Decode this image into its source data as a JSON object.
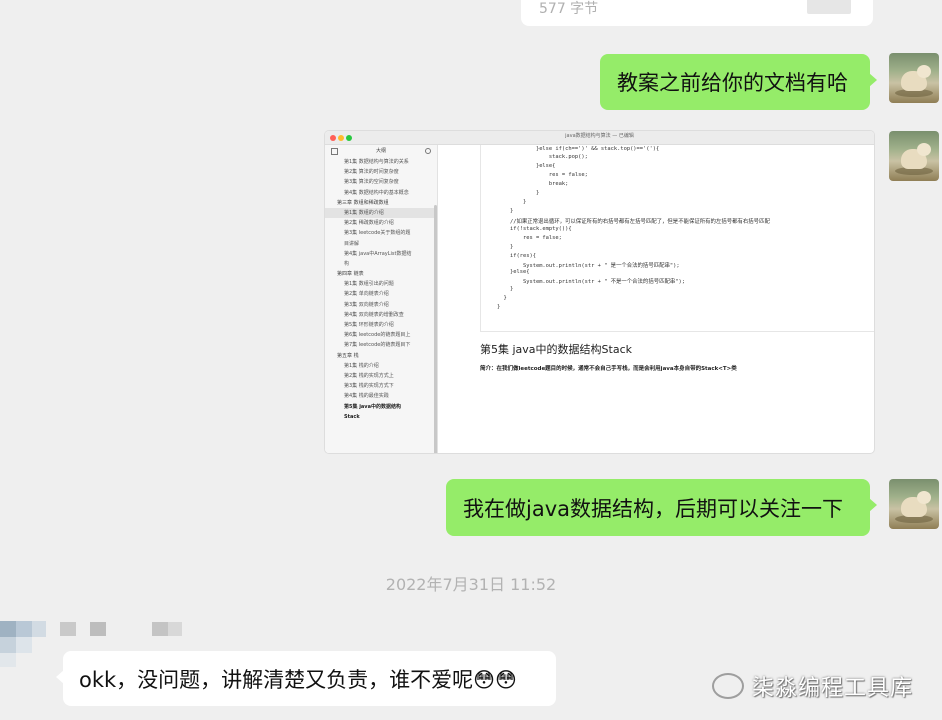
{
  "chat": {
    "top_partial_text": "577 字节",
    "messages": [
      {
        "from": "me",
        "text": "教案之前给你的文档有哈"
      },
      {
        "from": "me",
        "text": "我在做java数据结构，后期可以关注一下"
      },
      {
        "from": "other",
        "text": "okk，没问题，讲解清楚又负责，谁不爱呢😳😳"
      }
    ],
    "timestamp": "2022年7月31日 11:52"
  },
  "screenshot": {
    "window_title": "java数据结构与算法 — 已编辑",
    "sidebar_title": "大纲",
    "outline": [
      {
        "text": "第1集 数据结构与算法的关系",
        "level": "sec"
      },
      {
        "text": "第2集 算法的时间复杂度",
        "level": "sec"
      },
      {
        "text": "第3集 算法的空间复杂度",
        "level": "sec"
      },
      {
        "text": "第4集 数据结构中的基本概念",
        "level": "sec"
      },
      {
        "text": "第三章 数组和稀疏数组",
        "level": "ch"
      },
      {
        "text": "第1集 数组的介绍",
        "level": "sec",
        "selected": true
      },
      {
        "text": "第2集 稀疏数组的介绍",
        "level": "sec"
      },
      {
        "text": "第3集 leetcode关于数组的题",
        "level": "sec"
      },
      {
        "text": "目讲解",
        "level": "sec"
      },
      {
        "text": "第4集 java中ArrayList数据结",
        "level": "sec"
      },
      {
        "text": "构",
        "level": "sec"
      },
      {
        "text": "第四章 链表",
        "level": "ch"
      },
      {
        "text": "第1集 数组引出的问题",
        "level": "sec"
      },
      {
        "text": "第2集 单向链表介绍",
        "level": "sec"
      },
      {
        "text": "第3集 双向链表介绍",
        "level": "sec"
      },
      {
        "text": "第4集 双向链表的增删改查",
        "level": "sec"
      },
      {
        "text": "第5集 环形链表的介绍",
        "level": "sec"
      },
      {
        "text": "第6集 leetcode的链表题目上",
        "level": "sec"
      },
      {
        "text": "第7集 leetcode的链表题目下",
        "level": "sec"
      },
      {
        "text": "第五章 栈",
        "level": "ch"
      },
      {
        "text": "第1集 栈的介绍",
        "level": "sec"
      },
      {
        "text": "第2集 栈的实现方式上",
        "level": "sec"
      },
      {
        "text": "第3集 栈的实现方式下",
        "level": "sec"
      },
      {
        "text": "第4集 栈的最佳实践",
        "level": "sec"
      },
      {
        "text": "第5集 java中的数据结构",
        "level": "sec",
        "bold": true
      },
      {
        "text": "Stack",
        "level": "sec",
        "bold": true
      }
    ],
    "code_lines": [
      "            }else if(ch==')' && stack.top()=='('){",
      "                stack.pop();",
      "            }else{",
      "                res = false;",
      "                break;",
      "            }",
      "        }",
      "    }",
      "    //如果正常退出循环，可以保证所有的右括号都有左括号匹配了，但是不能保证所有的左括号都有右括号匹配",
      "    if(!stack.empty()){",
      "        res = false;",
      "    }",
      "    if(res){",
      "        System.out.println(str + \" 是一个合法的括号匹配串\");",
      "    }else{",
      "        System.out.println(str + \" 不是一个合法的括号匹配串\");",
      "    }",
      "  }",
      "}"
    ],
    "section_heading": "第5集 java中的数据结构Stack",
    "intro": "简介：在我们做leetcode题目的时候，通常不会自己手写栈，而是会利用java本身自带的Stack<T>类"
  },
  "watermark": "柒淼编程工具库",
  "colors": {
    "green": "#95ec69",
    "bg": "#efefef"
  }
}
